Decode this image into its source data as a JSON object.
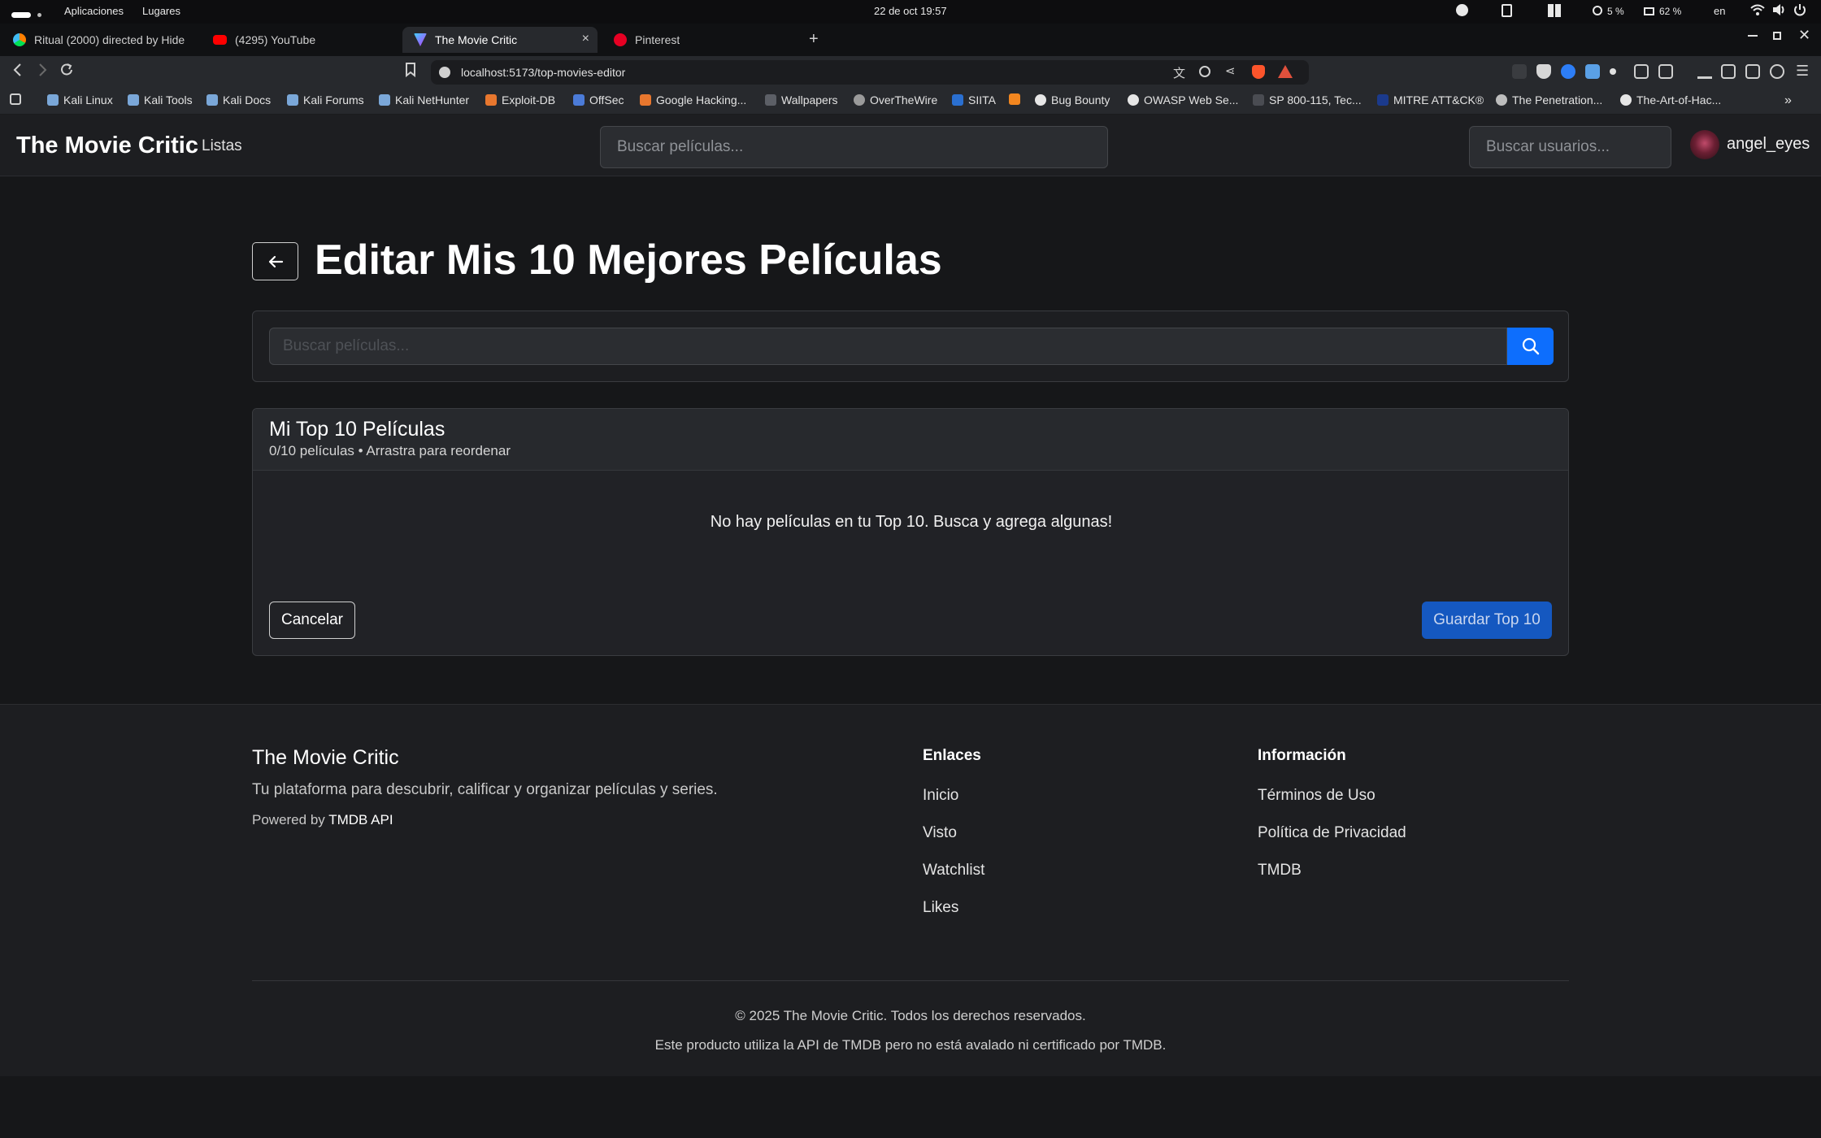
{
  "os": {
    "apps": "Aplicaciones",
    "places": "Lugares",
    "datetime": "22 de oct  19:57",
    "cpu": "5 %",
    "mem": "62 %",
    "lang": "en"
  },
  "tabs": [
    {
      "label": "Ritual (2000) directed by Hide",
      "favicon": "letterboxd-icon"
    },
    {
      "label": "(4295) YouTube",
      "favicon": "youtube-icon"
    },
    {
      "label": "The Movie Critic",
      "favicon": "vite-icon"
    },
    {
      "label": "Pinterest",
      "favicon": "pinterest-icon"
    }
  ],
  "tab_close": "×",
  "new_tab": "+",
  "url": "localhost:5173/top-movies-editor",
  "bookmarks": [
    "Kali Linux",
    "Kali Tools",
    "Kali Docs",
    "Kali Forums",
    "Kali NetHunter",
    "Exploit-DB",
    "OffSec",
    "Google Hacking...",
    "Wallpapers",
    "OverTheWire",
    "SIITA",
    "Bug Bounty",
    "OWASP Web Se...",
    "SP 800-115, Tec...",
    "MITRE ATT&CK®",
    "The Penetration...",
    "The-Art-of-Hac..."
  ],
  "app": {
    "brand": "The Movie Critic",
    "nav_lists": "Listas",
    "search_movies_placeholder": "Buscar películas...",
    "search_users_placeholder": "Buscar usuarios...",
    "username": "angel_eyes"
  },
  "main": {
    "title": "Editar Mis 10 Mejores Películas",
    "search_placeholder": "Buscar películas...",
    "card_title": "Mi Top 10 Películas",
    "card_subtitle": "0/10 películas • Arrastra para reordenar",
    "empty_message": "No hay películas en tu Top 10. Busca y agrega algunas!",
    "cancel": "Cancelar",
    "save": "Guardar Top 10"
  },
  "footer": {
    "brand": "The Movie Critic",
    "description": "Tu plataforma para descubrir, calificar y organizar películas y series.",
    "powered_prefix": "Powered by ",
    "powered_name": "TMDB API",
    "links_heading": "Enlaces",
    "links": [
      "Inicio",
      "Visto",
      "Watchlist",
      "Likes"
    ],
    "info_heading": "Información",
    "info_links": [
      "Términos de Uso",
      "Política de Privacidad",
      "TMDB"
    ],
    "copyright": "© 2025 The Movie Critic. Todos los derechos reservados.",
    "disclaimer": "Este producto utiliza la API de TMDB pero no está avalado ni certificado por TMDB."
  },
  "colors": {
    "accent": "#0d6efd",
    "save_button": "#1558c0",
    "background": "#161719"
  }
}
